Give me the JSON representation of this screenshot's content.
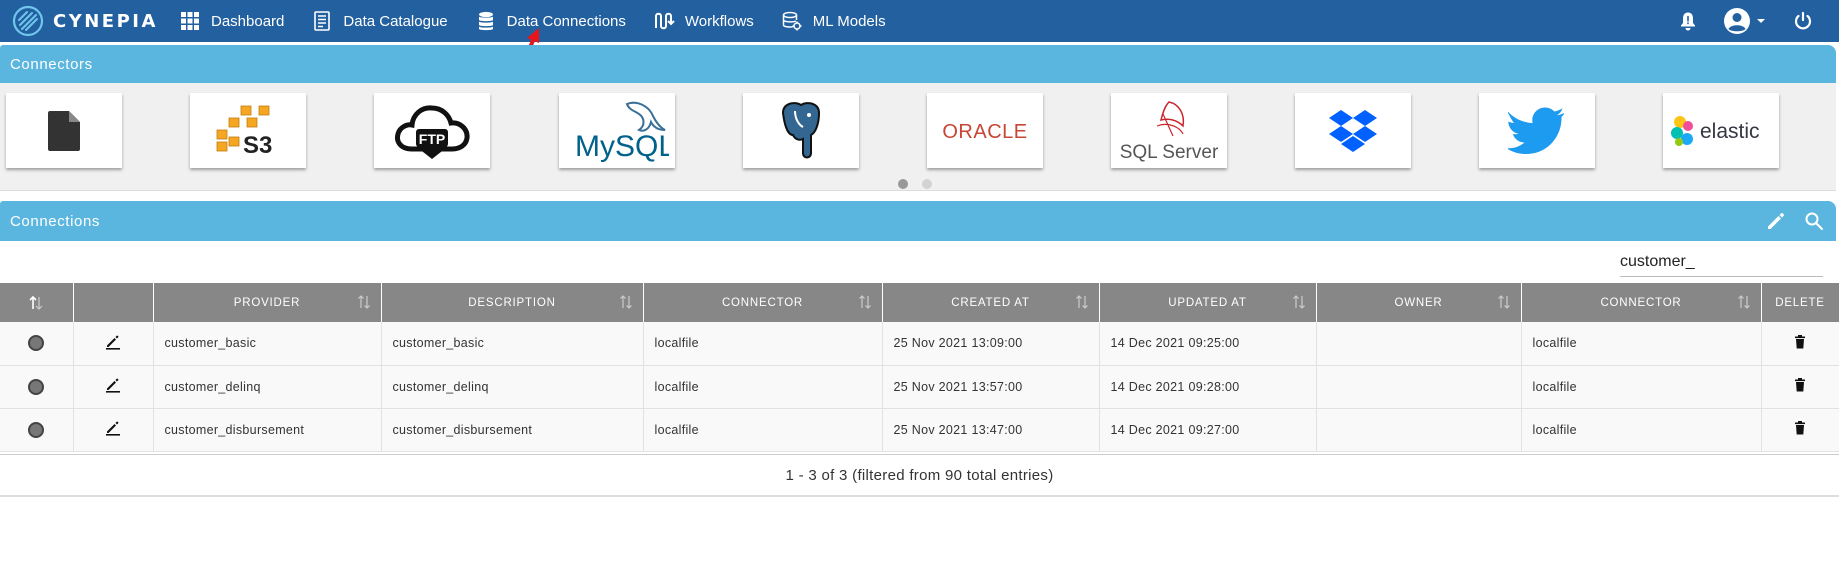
{
  "brand": {
    "name": "CYNEPIA"
  },
  "nav": {
    "items": [
      {
        "label": "Dashboard",
        "icon": "grid-icon"
      },
      {
        "label": "Data Catalogue",
        "icon": "document-list-icon"
      },
      {
        "label": "Data Connections",
        "icon": "database-icon"
      },
      {
        "label": "Workflows",
        "icon": "workflow-icon"
      },
      {
        "label": "ML Models",
        "icon": "database-gear-icon"
      }
    ],
    "right_icons": [
      "bell-icon",
      "user-account-icon",
      "power-icon"
    ]
  },
  "connectors": {
    "title": "Connectors",
    "tiles": [
      {
        "name": "File",
        "text": ""
      },
      {
        "name": "S3",
        "text": "S3"
      },
      {
        "name": "FTP",
        "text": "FTP"
      },
      {
        "name": "MySQL",
        "text": "MySQL"
      },
      {
        "name": "PostgreSQL",
        "text": ""
      },
      {
        "name": "Oracle",
        "text": "ORACLE"
      },
      {
        "name": "SQL Server",
        "text": "SQL Server"
      },
      {
        "name": "Dropbox",
        "text": ""
      },
      {
        "name": "Twitter",
        "text": ""
      },
      {
        "name": "Elastic",
        "text": "elastic"
      }
    ],
    "pages": 2,
    "active_page": 1
  },
  "connections": {
    "title": "Connections",
    "search": {
      "value": "customer_"
    },
    "columns": [
      "",
      "",
      "PROVIDER",
      "DESCRIPTION",
      "CONNECTOR",
      "CREATED AT",
      "UPDATED AT",
      "OWNER",
      "CONNECTOR",
      "DELETE"
    ],
    "rows": [
      {
        "provider": "customer_basic",
        "description": "customer_basic",
        "connector": "localfile",
        "created_at": "25 Nov 2021 13:09:00",
        "updated_at": "14 Dec 2021 09:25:00",
        "owner": "",
        "connector2": "localfile"
      },
      {
        "provider": "customer_delinq",
        "description": "customer_delinq",
        "connector": "localfile",
        "created_at": "25 Nov 2021 13:57:00",
        "updated_at": "14 Dec 2021 09:28:00",
        "owner": "",
        "connector2": "localfile"
      },
      {
        "provider": "customer_disbursement",
        "description": "customer_disbursement",
        "connector": "localfile",
        "created_at": "25 Nov 2021 13:47:00",
        "updated_at": "14 Dec 2021 09:27:00",
        "owner": "",
        "connector2": "localfile"
      }
    ],
    "footer": "1 - 3 of 3 (filtered from 90 total entries)"
  },
  "colors": {
    "navbar": "#2360a0",
    "panel_header": "#5ab6df",
    "table_header": "#878787",
    "annotation": "#e8161b"
  }
}
